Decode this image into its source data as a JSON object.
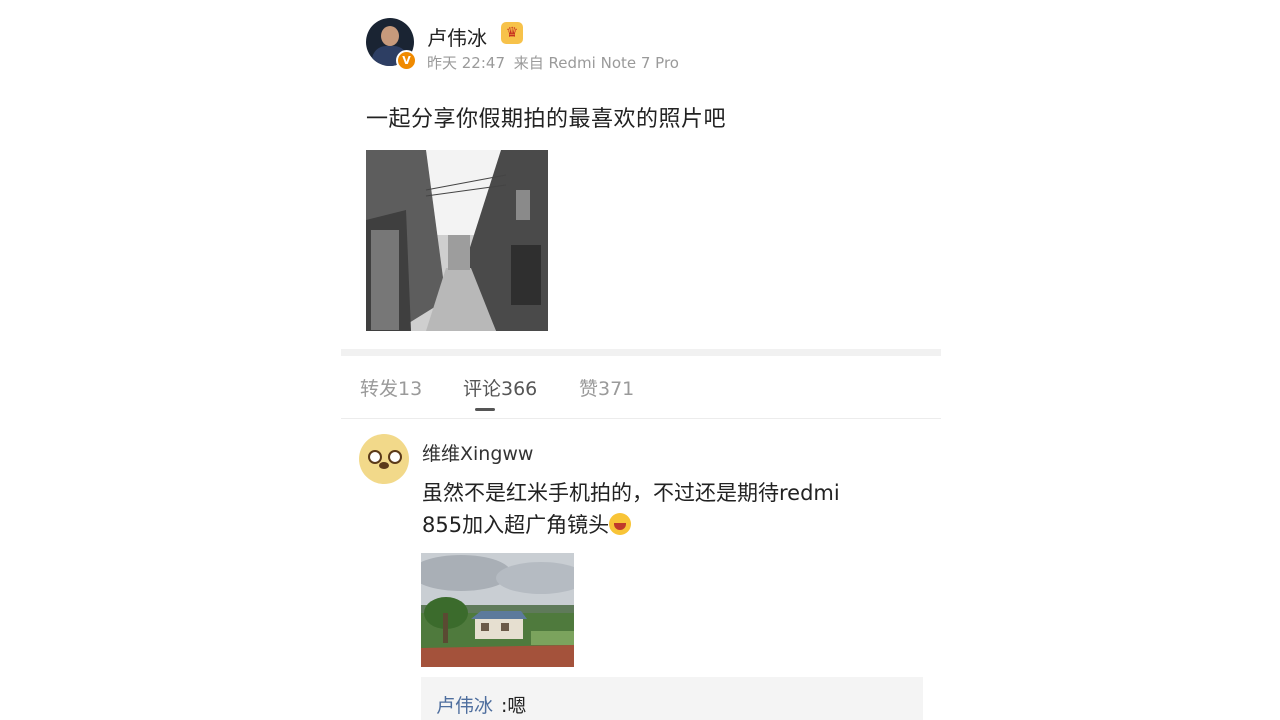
{
  "post": {
    "author": "卢伟冰",
    "verified_badge": "V",
    "time": "昨天 22:47",
    "source": "来自 Redmi Note 7 Pro",
    "text": "一起分享你假期拍的最喜欢的照片吧",
    "image_icon": "alley-photo"
  },
  "tabs": {
    "repost": "转发13",
    "comments": "评论366",
    "likes": "赞371",
    "active": "comments"
  },
  "comment": {
    "author": "维维Xingww",
    "line1": "虽然不是红米手机拍的，不过还是期待redmi",
    "line2": "855加入超广角镜头",
    "emoji": "laugh-icon",
    "image_icon": "house-landscape-photo"
  },
  "reply": {
    "author": "卢伟冰",
    "text": ":嗯"
  },
  "colors": {
    "link_blue": "#4e6e9e",
    "muted_gray": "#9a9a9a",
    "badge_orange": "#f08a00"
  }
}
